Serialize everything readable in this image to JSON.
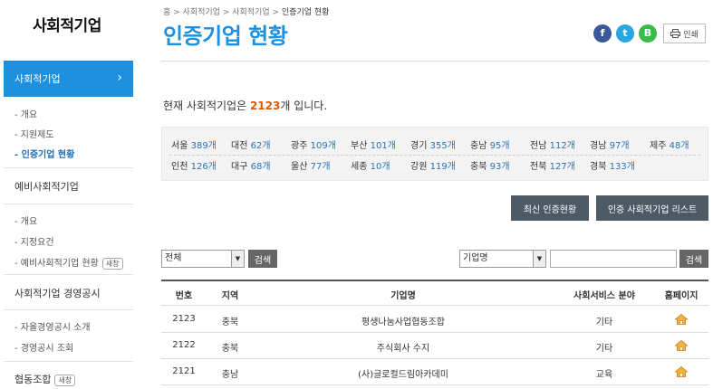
{
  "sidebar": {
    "title": "사회적기업",
    "active_item": "사회적기업",
    "active_subs": [
      "- 개요",
      "- 지원제도",
      "- 인증기업 현황"
    ],
    "section2": "예비사회적기업",
    "section2_subs": [
      "- 개요",
      "- 지정요건",
      "- 예비사회적기업 현황"
    ],
    "section3": "사회적기업 경영공시",
    "section3_subs": [
      "- 자율경영공시 소개",
      "- 경영공시 조회"
    ],
    "section4": "협동조합",
    "new_badge": "새창"
  },
  "header": {
    "breadcrumb": [
      "홈",
      "사회적기업",
      "사회적기업",
      "인증기업 현황"
    ],
    "title": "인증기업 현황",
    "print_label": "인쇄",
    "share": {
      "facebook": "f",
      "twitter": "t",
      "blog": "B"
    }
  },
  "summary": {
    "prefix": "현재 사회적기업은 ",
    "count": "2123",
    "suffix": "개 입니다."
  },
  "regions": [
    {
      "name": "서울",
      "count": "389개"
    },
    {
      "name": "대전",
      "count": "62개"
    },
    {
      "name": "광주",
      "count": "109개"
    },
    {
      "name": "부산",
      "count": "101개"
    },
    {
      "name": "경기",
      "count": "355개"
    },
    {
      "name": "충남",
      "count": "95개"
    },
    {
      "name": "전남",
      "count": "112개"
    },
    {
      "name": "경남",
      "count": "97개"
    },
    {
      "name": "제주",
      "count": "48개"
    },
    {
      "name": "인천",
      "count": "126개"
    },
    {
      "name": "대구",
      "count": "68개"
    },
    {
      "name": "울산",
      "count": "77개"
    },
    {
      "name": "세종",
      "count": "10개"
    },
    {
      "name": "강원",
      "count": "119개"
    },
    {
      "name": "충북",
      "count": "93개"
    },
    {
      "name": "전북",
      "count": "127개"
    },
    {
      "name": "경북",
      "count": "133개"
    }
  ],
  "buttons": {
    "latest": "최신 인증현황",
    "list": "인증 사회적기업 리스트",
    "search": "검색"
  },
  "filters": {
    "region_select": "전체",
    "field_select": "기업명",
    "keyword": ""
  },
  "table": {
    "headers": [
      "번호",
      "지역",
      "기업명",
      "사회서비스 분야",
      "홈페이지"
    ],
    "rows": [
      {
        "no": "2123",
        "region": "충북",
        "name": "평생나눔사업협동조합",
        "field": "기타"
      },
      {
        "no": "2122",
        "region": "충북",
        "name": "주식회사 수지",
        "field": "기타"
      },
      {
        "no": "2121",
        "region": "충남",
        "name": "(사)글로컬드림아카데미",
        "field": "교육"
      }
    ]
  },
  "colors": {
    "accent": "#1e90e0",
    "count_highlight": "#e05a00",
    "button_dark": "#4d5a66"
  }
}
